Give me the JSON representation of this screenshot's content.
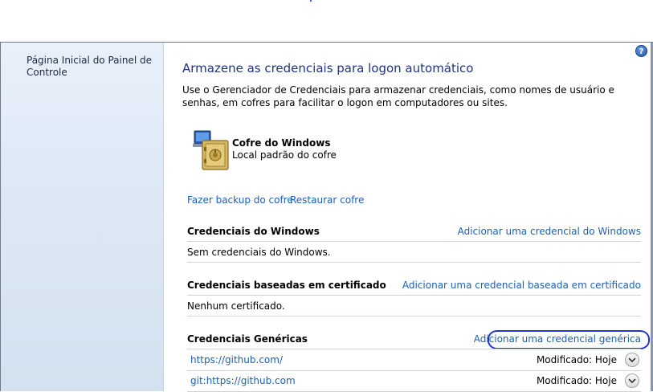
{
  "nav": {
    "home_link": "Página Inicial do Painel de Controle"
  },
  "help": {
    "label": "?"
  },
  "main": {
    "title": "Armazene as credenciais para logon automático",
    "description": "Use o Gerenciador de Credenciais para armazenar credenciais, como nomes de usuário e senhas, em cofres para facilitar o logon em computadores ou sites."
  },
  "vault": {
    "name": "Cofre do Windows",
    "subtitle": "Local padrão do cofre",
    "backup_link": "Fazer backup do cofre",
    "restore_link": "Restaurar cofre"
  },
  "sections": {
    "windows": {
      "heading": "Credenciais do Windows",
      "add_link": "Adicionar uma credencial do Windows",
      "empty_text": "Sem credenciais do Windows."
    },
    "certificate": {
      "heading": "Credenciais baseadas em certificado",
      "add_link": "Adicionar uma credencial baseada em certificado",
      "empty_text": "Nenhum certificado."
    },
    "generic": {
      "heading": "Credenciais Genéricas",
      "add_link": "Adicionar uma credencial genérica",
      "items": [
        {
          "address": "https://github.com/",
          "modified": "Modificado:  Hoje"
        },
        {
          "address": "git:https://github.com",
          "modified": "Modificado:  Hoje"
        }
      ]
    }
  },
  "colors": {
    "title": "#1e3287",
    "link": "#1d5fb8",
    "annotation_oval": "#1f35d6",
    "nav_pane": "#dde8f5"
  },
  "icons": [
    "vault-safe-icon",
    "help-icon",
    "chevron-down-icon"
  ]
}
